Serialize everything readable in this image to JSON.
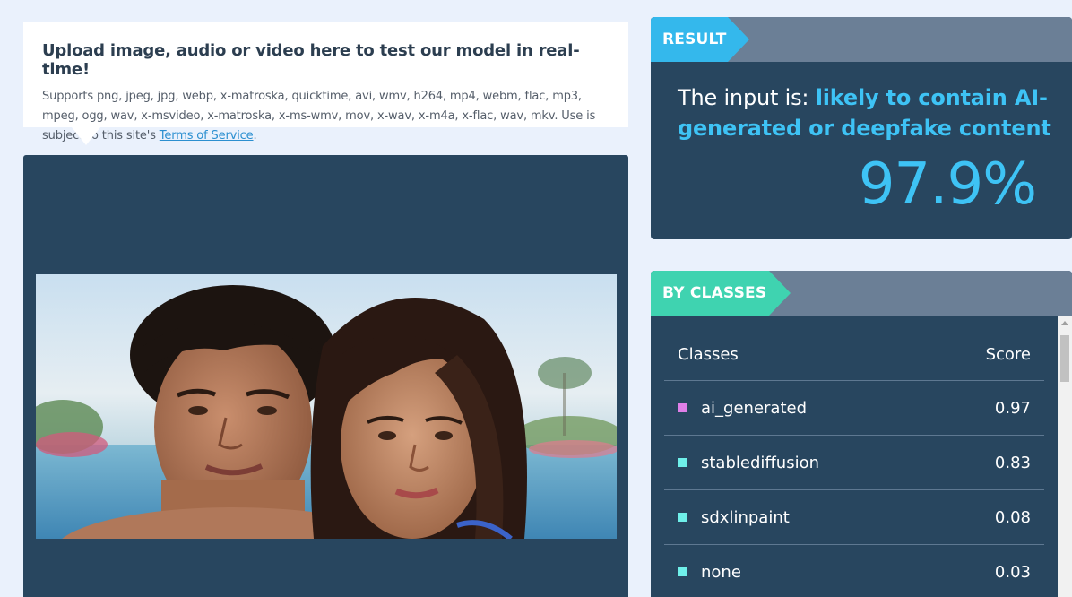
{
  "upload": {
    "title": "Upload image, audio or video here to test our model in real-time!",
    "description": "Supports png, jpeg, jpg, webp, x-matroska, quicktime, avi, wmv, h264, mp4, webm, flac, mp3, mpeg, ogg, wav, x-msvideo, x-matroska, x-ms-wmv, mov, x-wav, x-m4a, x-flac, wav, mkv. Use is subject to this site's ",
    "tos_link": "Terms of Service",
    "tos_suffix": "."
  },
  "result": {
    "tag": "RESULT",
    "prefix": "The input is: ",
    "verdict": "likely to contain AI-generated or deepfake content",
    "percent": "97.9%"
  },
  "classes": {
    "tag": "BY CLASSES",
    "header_class": "Classes",
    "header_score": "Score",
    "rows": [
      {
        "name": "ai_generated",
        "score": "0.97",
        "color": "#e07fe8"
      },
      {
        "name": "stablediffusion",
        "score": "0.83",
        "color": "#6ff0ea"
      },
      {
        "name": "sdxlinpaint",
        "score": "0.08",
        "color": "#6ff0ea"
      },
      {
        "name": "none",
        "score": "0.03",
        "color": "#6ff0ea"
      }
    ]
  },
  "colors": {
    "accent": "#3ec3f5",
    "panel": "#28465f",
    "classes_tag": "#3fd3b0"
  }
}
